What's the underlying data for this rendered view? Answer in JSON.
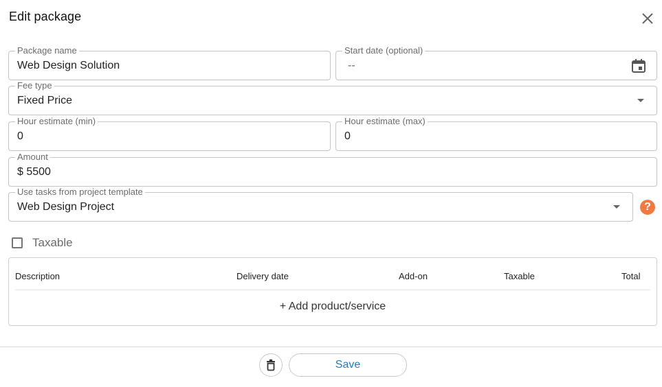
{
  "dialog": {
    "title": "Edit package",
    "close_icon": "close-icon"
  },
  "fields": {
    "package_name": {
      "label": "Package name",
      "value": "Web Design Solution"
    },
    "start_date": {
      "label": "Start date (optional)",
      "value": "--",
      "icon": "calendar-icon"
    },
    "fee_type": {
      "label": "Fee type",
      "value": "Fixed Price",
      "icon": "chevron-down-icon"
    },
    "hour_min": {
      "label": "Hour estimate (min)",
      "value": "0"
    },
    "hour_max": {
      "label": "Hour estimate (max)",
      "value": "0"
    },
    "amount": {
      "label": "Amount",
      "value": "$ 5500"
    },
    "project_template": {
      "label": "Use tasks from project template",
      "value": "Web Design Project",
      "icon": "chevron-down-icon"
    }
  },
  "help": {
    "glyph": "?",
    "color": "#f07a42"
  },
  "taxable": {
    "label": "Taxable",
    "checked": false
  },
  "table": {
    "columns": [
      "Description",
      "Delivery date",
      "Add-on",
      "Taxable",
      "Total"
    ],
    "rows": [],
    "add_label": "+ Add product/service"
  },
  "footer": {
    "delete_icon": "trash-icon",
    "save_label": "Save",
    "accent": "#1f7fb5"
  }
}
